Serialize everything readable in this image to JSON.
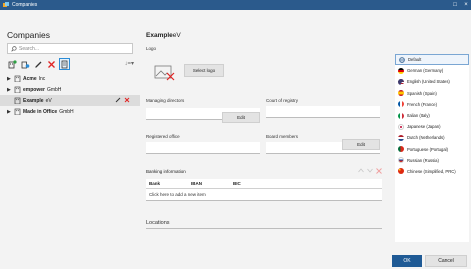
{
  "window": {
    "title": "Companies",
    "restore_glyph": "□",
    "close_glyph": "×"
  },
  "left": {
    "title": "Companies",
    "search_placeholder": "Search...",
    "toolbar": {
      "icons": [
        "add-company-icon",
        "copy-icon",
        "edit-icon",
        "delete-icon",
        "properties-icon"
      ],
      "sort_glyph": "↓=▾"
    },
    "tree": [
      {
        "name": "Acme",
        "suffix": "Inc"
      },
      {
        "name": "empower",
        "suffix": "GmbH"
      },
      {
        "name": "Example",
        "suffix": "eV"
      },
      {
        "name": "Made in Office",
        "suffix": "GmbH"
      }
    ],
    "selected_index": 2
  },
  "detail": {
    "title_name": "Example",
    "title_suffix": "eV",
    "logo_label": "Logo",
    "select_logo_label": "Select logo",
    "managing_directors_label": "Managing directors",
    "court_of_registry_label": "Court of registry",
    "edit_label": "Edit",
    "registered_office_label": "Registered office",
    "board_members_label": "Board members",
    "banking_label": "Banking information",
    "bank_columns": [
      "Bank",
      "IBAN",
      "BIC"
    ],
    "add_row_text": "Click here to add a new item",
    "locations_label": "Locations"
  },
  "languages": [
    {
      "label": "Default",
      "icon": "globe-icon"
    },
    {
      "label": "German (Germany)",
      "icon": "flag-germany-icon"
    },
    {
      "label": "English (United States)",
      "icon": "flag-us-icon"
    },
    {
      "label": "Spanish (Spain)",
      "icon": "flag-spain-icon"
    },
    {
      "label": "French (France)",
      "icon": "flag-france-icon"
    },
    {
      "label": "Italian (Italy)",
      "icon": "flag-italy-icon"
    },
    {
      "label": "Japanese (Japan)",
      "icon": "flag-japan-icon"
    },
    {
      "label": "Dutch (Netherlands)",
      "icon": "flag-netherlands-icon"
    },
    {
      "label": "Portuguese (Portugal)",
      "icon": "flag-portugal-icon"
    },
    {
      "label": "Russian (Russia)",
      "icon": "flag-russia-icon"
    },
    {
      "label": "Chinese (Simplified, PRC)",
      "icon": "flag-china-icon"
    }
  ],
  "footer": {
    "ok_label": "OK",
    "cancel_label": "Cancel"
  },
  "colors": {
    "titlebar": "#2b5a8c",
    "accent": "#1f5a95",
    "delete": "#e02424",
    "selection": "#2b8cd6"
  }
}
